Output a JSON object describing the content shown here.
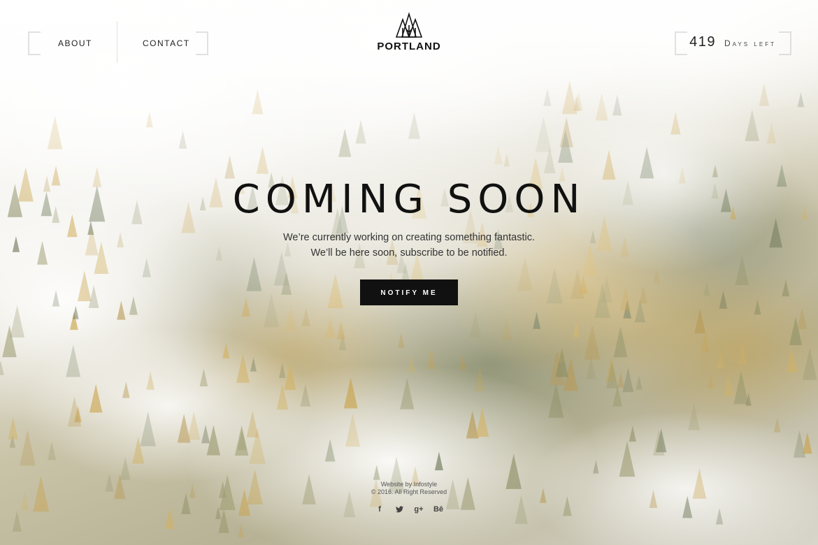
{
  "header": {
    "nav": [
      {
        "label": "ABOUT"
      },
      {
        "label": "CONTACT"
      }
    ],
    "logo_text": "PORTLAND",
    "counter": {
      "number": "419",
      "label": "Days left"
    }
  },
  "hero": {
    "title": "COMING SOON",
    "line1": "We’re currently working on creating something fantastic.",
    "line2": "We’ll be here soon, subscribe to be notified.",
    "button_label": "NOTIFY ME"
  },
  "footer": {
    "credit": "Website by Infostyle",
    "copyright": "© 2016. All Right Reserved",
    "socials": [
      {
        "icon": "facebook-icon",
        "glyph": "f"
      },
      {
        "icon": "twitter-icon",
        "glyph": "🐦"
      },
      {
        "icon": "google-plus-icon",
        "glyph": "g+"
      },
      {
        "icon": "behance-icon",
        "glyph": "Bē"
      }
    ]
  },
  "colors": {
    "button_bg": "#111111",
    "text": "#222222",
    "bracket": "#c8c8c8"
  }
}
